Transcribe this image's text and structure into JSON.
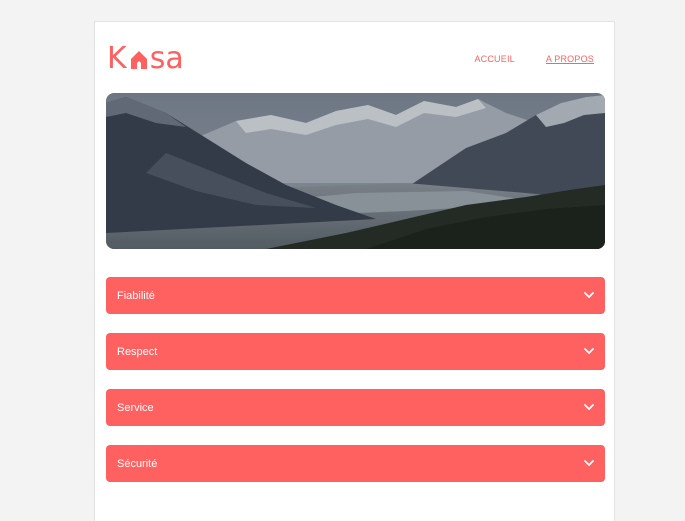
{
  "brand": {
    "logo_prefix": "K",
    "logo_suffix": "sa",
    "accent_color": "#ff6060"
  },
  "nav": {
    "items": [
      {
        "label": "ACCUEIL",
        "active": false
      },
      {
        "label": "A PROPOS",
        "active": true
      }
    ]
  },
  "banner": {
    "icon": "mountain-landscape-image"
  },
  "collapses": [
    {
      "label": "Fiabilité",
      "icon": "chevron-down-icon"
    },
    {
      "label": "Respect",
      "icon": "chevron-down-icon"
    },
    {
      "label": "Service",
      "icon": "chevron-down-icon"
    },
    {
      "label": "Sécurité",
      "icon": "chevron-down-icon"
    }
  ]
}
